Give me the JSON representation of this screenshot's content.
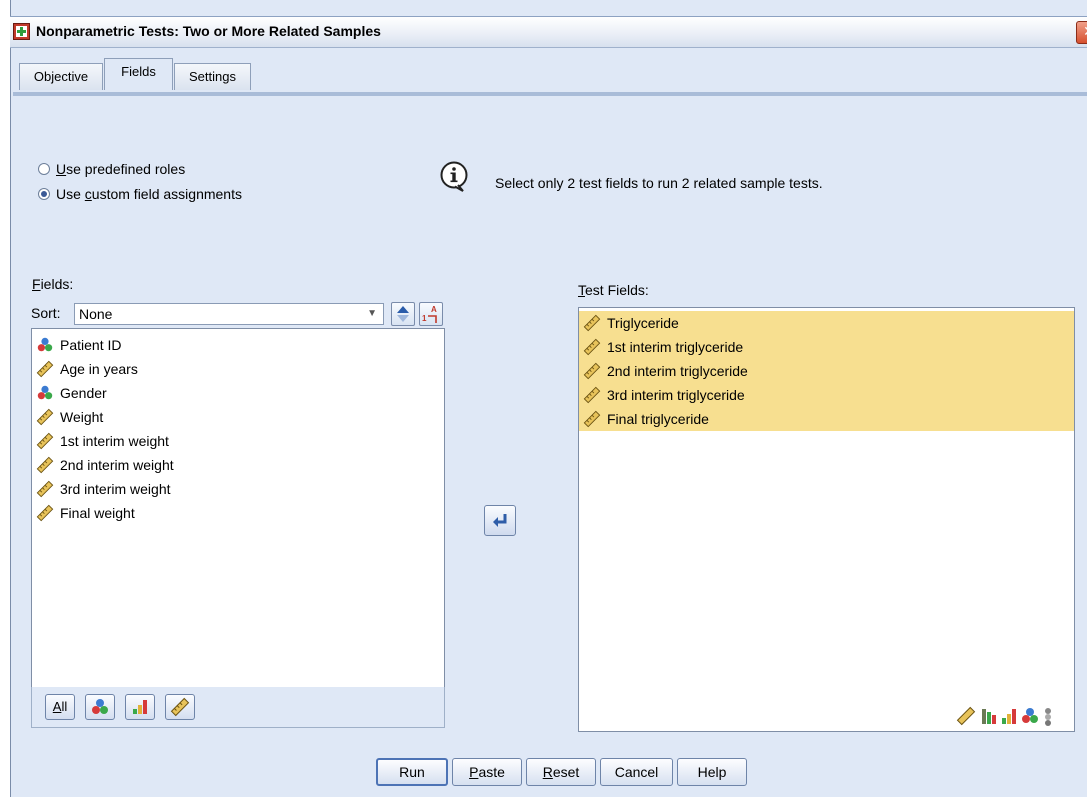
{
  "window": {
    "title": "Nonparametric Tests: Two or More Related Samples",
    "close_glyph": "✕"
  },
  "tabs": [
    {
      "label": "Objective",
      "active": false
    },
    {
      "label": "Fields",
      "active": true
    },
    {
      "label": "Settings",
      "active": false
    }
  ],
  "roles": {
    "predefined": {
      "pre": "",
      "accel": "U",
      "post": "se predefined roles",
      "selected": false
    },
    "custom": {
      "pre": "Use ",
      "accel": "c",
      "post": "ustom field assignments",
      "selected": true
    }
  },
  "info": {
    "icon": "info-icon",
    "text": "Select only 2 test fields to run 2 related sample tests."
  },
  "fields_panel": {
    "label_accel": "F",
    "label_rest": "ields:",
    "sort_label": "Sort:",
    "sort_value": "None",
    "items": [
      {
        "label": "Patient ID",
        "icon": "nominal-icon"
      },
      {
        "label": "Age in years",
        "icon": "scale-icon"
      },
      {
        "label": "Gender",
        "icon": "nominal-icon"
      },
      {
        "label": "Weight",
        "icon": "scale-icon"
      },
      {
        "label": "1st interim weight",
        "icon": "scale-icon"
      },
      {
        "label": "2nd interim weight",
        "icon": "scale-icon"
      },
      {
        "label": "3rd interim weight",
        "icon": "scale-icon"
      },
      {
        "label": "Final weight",
        "icon": "scale-icon"
      }
    ],
    "filter_buttons": {
      "all_accel": "A",
      "all_rest": "ll"
    }
  },
  "test_fields_panel": {
    "label_accel": "T",
    "label_rest": "est Fields:",
    "items": [
      {
        "label": "Triglyceride",
        "icon": "scale-icon"
      },
      {
        "label": "1st interim triglyceride",
        "icon": "scale-icon"
      },
      {
        "label": "2nd interim triglyceride",
        "icon": "scale-icon"
      },
      {
        "label": "3rd interim triglyceride",
        "icon": "scale-icon"
      },
      {
        "label": "Final triglyceride",
        "icon": "scale-icon"
      }
    ],
    "selected_fill": "#f7df90"
  },
  "buttons": {
    "run": "Run",
    "paste_accel": "P",
    "paste_rest": "aste",
    "reset_accel": "R",
    "reset_rest": "eset",
    "cancel": "Cancel",
    "help": "Help"
  },
  "colors": {
    "dialog_bg": "#dfe8f6",
    "selection": "#f7df90",
    "accent": "#4d73b5"
  }
}
